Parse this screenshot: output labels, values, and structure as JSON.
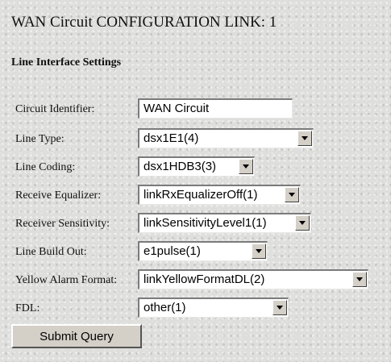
{
  "page_title": "WAN Circuit CONFIGURATION LINK: 1",
  "section_title": "Line Interface Settings",
  "fields": {
    "circuit_identifier": {
      "label": "Circuit Identifier:",
      "value": "WAN Circuit"
    },
    "line_type": {
      "label": "Line Type:",
      "value": "dsx1E1(4)"
    },
    "line_coding": {
      "label": "Line Coding:",
      "value": "dsx1HDB3(3)"
    },
    "receive_equalizer": {
      "label": "Receive Equalizer:",
      "value": "linkRxEqualizerOff(1)"
    },
    "receiver_sensitivity": {
      "label": "Receiver Sensitivity:",
      "value": "linkSensitivityLevel1(1)"
    },
    "line_build_out": {
      "label": "Line Build Out:",
      "value": "e1pulse(1)"
    },
    "yellow_alarm_format": {
      "label": "Yellow Alarm Format:",
      "value": "linkYellowFormatDL(2)"
    },
    "fdl": {
      "label": "FDL:",
      "value": "other(1)"
    }
  },
  "submit_label": "Submit Query"
}
